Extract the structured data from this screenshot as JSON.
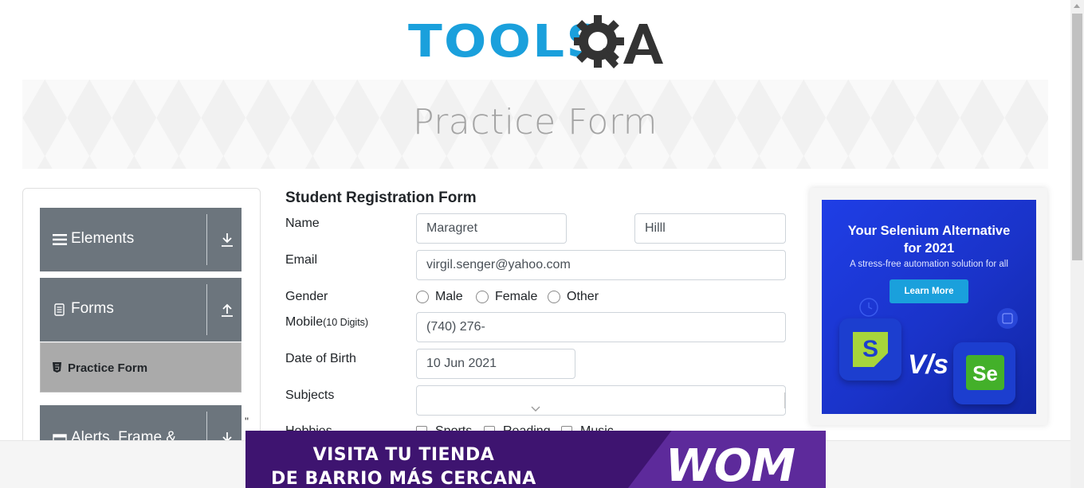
{
  "header": {
    "logo_text": "TOOLS",
    "logo_qa": "QA"
  },
  "banner": {
    "title": "Practice Form"
  },
  "sidebar": {
    "groups": [
      {
        "label": "Elements",
        "icon": "hamburger-icon",
        "arrow": "download-arrow-icon"
      },
      {
        "label": "Forms",
        "icon": "form-icon",
        "arrow": "upload-arrow-icon"
      },
      {
        "label": "Alerts, Frame &",
        "icon": "window-icon",
        "arrow": "download-arrow-icon"
      }
    ],
    "active_item": {
      "label": "Practice Form",
      "icon": "html5-icon"
    },
    "stray_char": "\""
  },
  "form": {
    "title": "Student Registration Form",
    "labels": {
      "name": "Name",
      "email": "Email",
      "gender": "Gender",
      "mobile": "Mobile",
      "mobile_hint": "(10 Digits)",
      "dob": "Date of Birth",
      "subjects": "Subjects",
      "hobbies": "Hobbies"
    },
    "first_name": "Maragret",
    "last_name": "Hilll",
    "email": "virgil.senger@yahoo.com",
    "gender_options": [
      "Male",
      "Female",
      "Other"
    ],
    "mobile": "(740) 276-",
    "dob": "10 Jun 2021",
    "subjects": "",
    "hobbies_options": [
      "Sports",
      "Reading",
      "Music"
    ]
  },
  "right_ad": {
    "title_line1": "Your Selenium Alternative",
    "title_line2": "for 2021",
    "subtitle": "A stress-free automation solution for all",
    "button": "Learn More",
    "vs": "V/s",
    "left_tile": "S",
    "right_tile": "Se",
    "accent": "#1aa0dc"
  },
  "bottom_ad": {
    "line1": "VISITA TU TIENDA",
    "line2": "DE BARRIO MÁS CERCANA",
    "brand": "WOM",
    "bg": "#3e1470",
    "accent": "#5d2a9b"
  },
  "colors": {
    "sidebar_group": "#6c757d",
    "active_item": "#aaaaaa",
    "logo_blue": "#1aa0dc",
    "logo_dark": "#333333"
  }
}
